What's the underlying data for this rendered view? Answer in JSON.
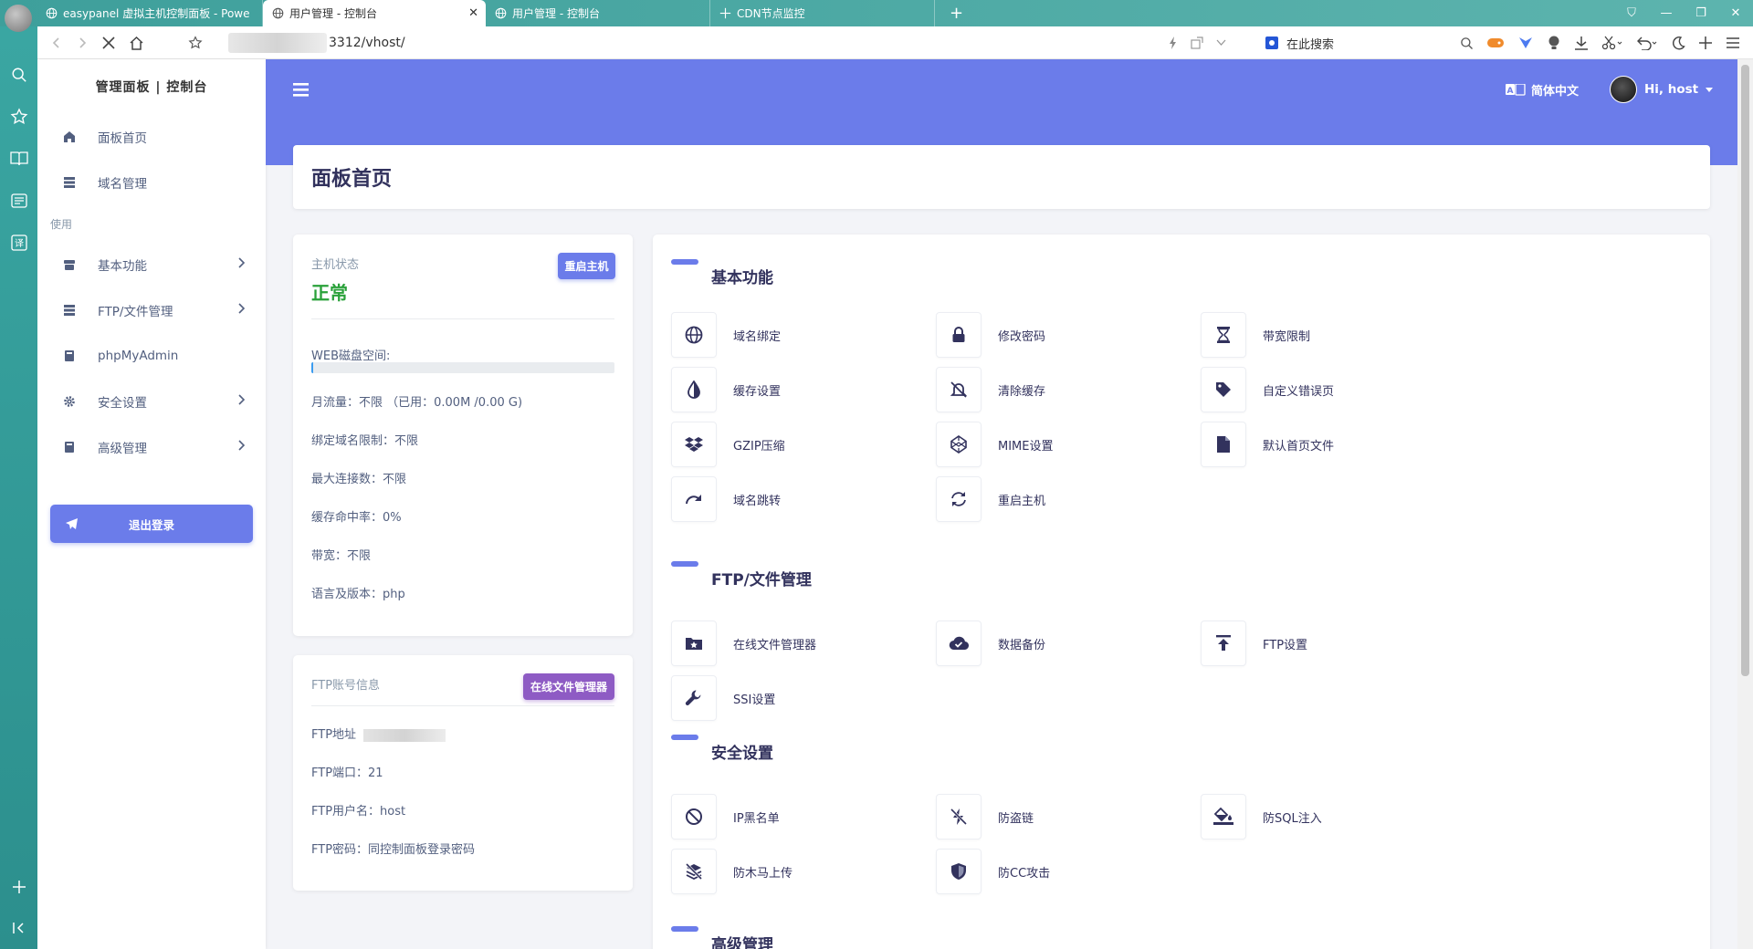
{
  "browser": {
    "tabs": [
      {
        "label": "easypanel 虚拟主机控制面板 - Powe",
        "active": false
      },
      {
        "label": "用户管理 - 控制台",
        "active": true
      },
      {
        "label": "用户管理 - 控制台",
        "active": false
      },
      {
        "label": "CDN节点监控",
        "active": false
      }
    ],
    "url_suffix": "3312/vhost/",
    "search_placeholder": "在此搜索"
  },
  "sidebar": {
    "brand": "管理面板 | 控制台",
    "top_items": [
      {
        "label": "面板首页",
        "icon": "home-icon"
      },
      {
        "label": "域名管理",
        "icon": "list-icon"
      }
    ],
    "section_label": "使用",
    "items": [
      {
        "label": "基本功能",
        "icon": "archive-icon",
        "has_sub": true
      },
      {
        "label": "FTP/文件管理",
        "icon": "server-icon",
        "has_sub": true
      },
      {
        "label": "phpMyAdmin",
        "icon": "book-icon",
        "has_sub": false
      },
      {
        "label": "安全设置",
        "icon": "gear-icon",
        "has_sub": true
      },
      {
        "label": "高级管理",
        "icon": "book-icon",
        "has_sub": true
      }
    ],
    "logout_label": "退出登录"
  },
  "header": {
    "language": "简体中文",
    "user_greeting": "Hi, host"
  },
  "page_title": "面板首页",
  "status_card": {
    "label": "主机状态",
    "value": "正常",
    "restart_button": "重启主机",
    "disk_label": "WEB磁盘空间:",
    "disk_usage_fraction": 0.006,
    "lines": [
      "月流量：不限 （已用：0.00M /0.00 G)",
      "绑定域名限制：不限",
      "最大连接数：不限",
      "缓存命中率：0%",
      "带宽：不限",
      "语言及版本：php"
    ]
  },
  "ftp_card": {
    "label": "FTP账号信息",
    "button": "在线文件管理器",
    "address_label": "FTP地址",
    "port": "FTP端口：21",
    "username": "FTP用户名：host",
    "password": "FTP密码：同控制面板登录密码"
  },
  "functions": {
    "basic": {
      "title": "基本功能",
      "items": [
        {
          "label": "域名绑定",
          "icon": "globe-icon"
        },
        {
          "label": "修改密码",
          "icon": "lock-icon"
        },
        {
          "label": "带宽限制",
          "icon": "hourglass-icon"
        },
        {
          "label": "缓存设置",
          "icon": "contrast-icon"
        },
        {
          "label": "清除缓存",
          "icon": "bell-slash-icon"
        },
        {
          "label": "自定义错误页",
          "icon": "tag-icon"
        },
        {
          "label": "GZIP压缩",
          "icon": "dropbox-icon"
        },
        {
          "label": "MIME设置",
          "icon": "codepen-icon"
        },
        {
          "label": "默认首页文件",
          "icon": "file-icon"
        },
        {
          "label": "域名跳转",
          "icon": "redo-icon"
        },
        {
          "label": "重启主机",
          "icon": "sync-icon"
        }
      ]
    },
    "ftp": {
      "title": "FTP/文件管理",
      "items": [
        {
          "label": "在线文件管理器",
          "icon": "folder-star-icon"
        },
        {
          "label": "数据备份",
          "icon": "cloud-check-icon"
        },
        {
          "label": "FTP设置",
          "icon": "upload-icon"
        },
        {
          "label": "SSI设置",
          "icon": "wrench-icon"
        }
      ]
    },
    "security": {
      "title": "安全设置",
      "items": [
        {
          "label": "IP黑名单",
          "icon": "ban-icon"
        },
        {
          "label": "防盗链",
          "icon": "bolt-slash-icon"
        },
        {
          "label": "防SQL注入",
          "icon": "fill-drip-icon"
        },
        {
          "label": "防木马上传",
          "icon": "layers-slash-icon"
        },
        {
          "label": "防CC攻击",
          "icon": "shield-icon"
        }
      ]
    },
    "advanced": {
      "title": "高级管理"
    }
  },
  "colors": {
    "primary": "#6b7cea",
    "success": "#2aa13a",
    "purple": "#8e5bc4"
  }
}
